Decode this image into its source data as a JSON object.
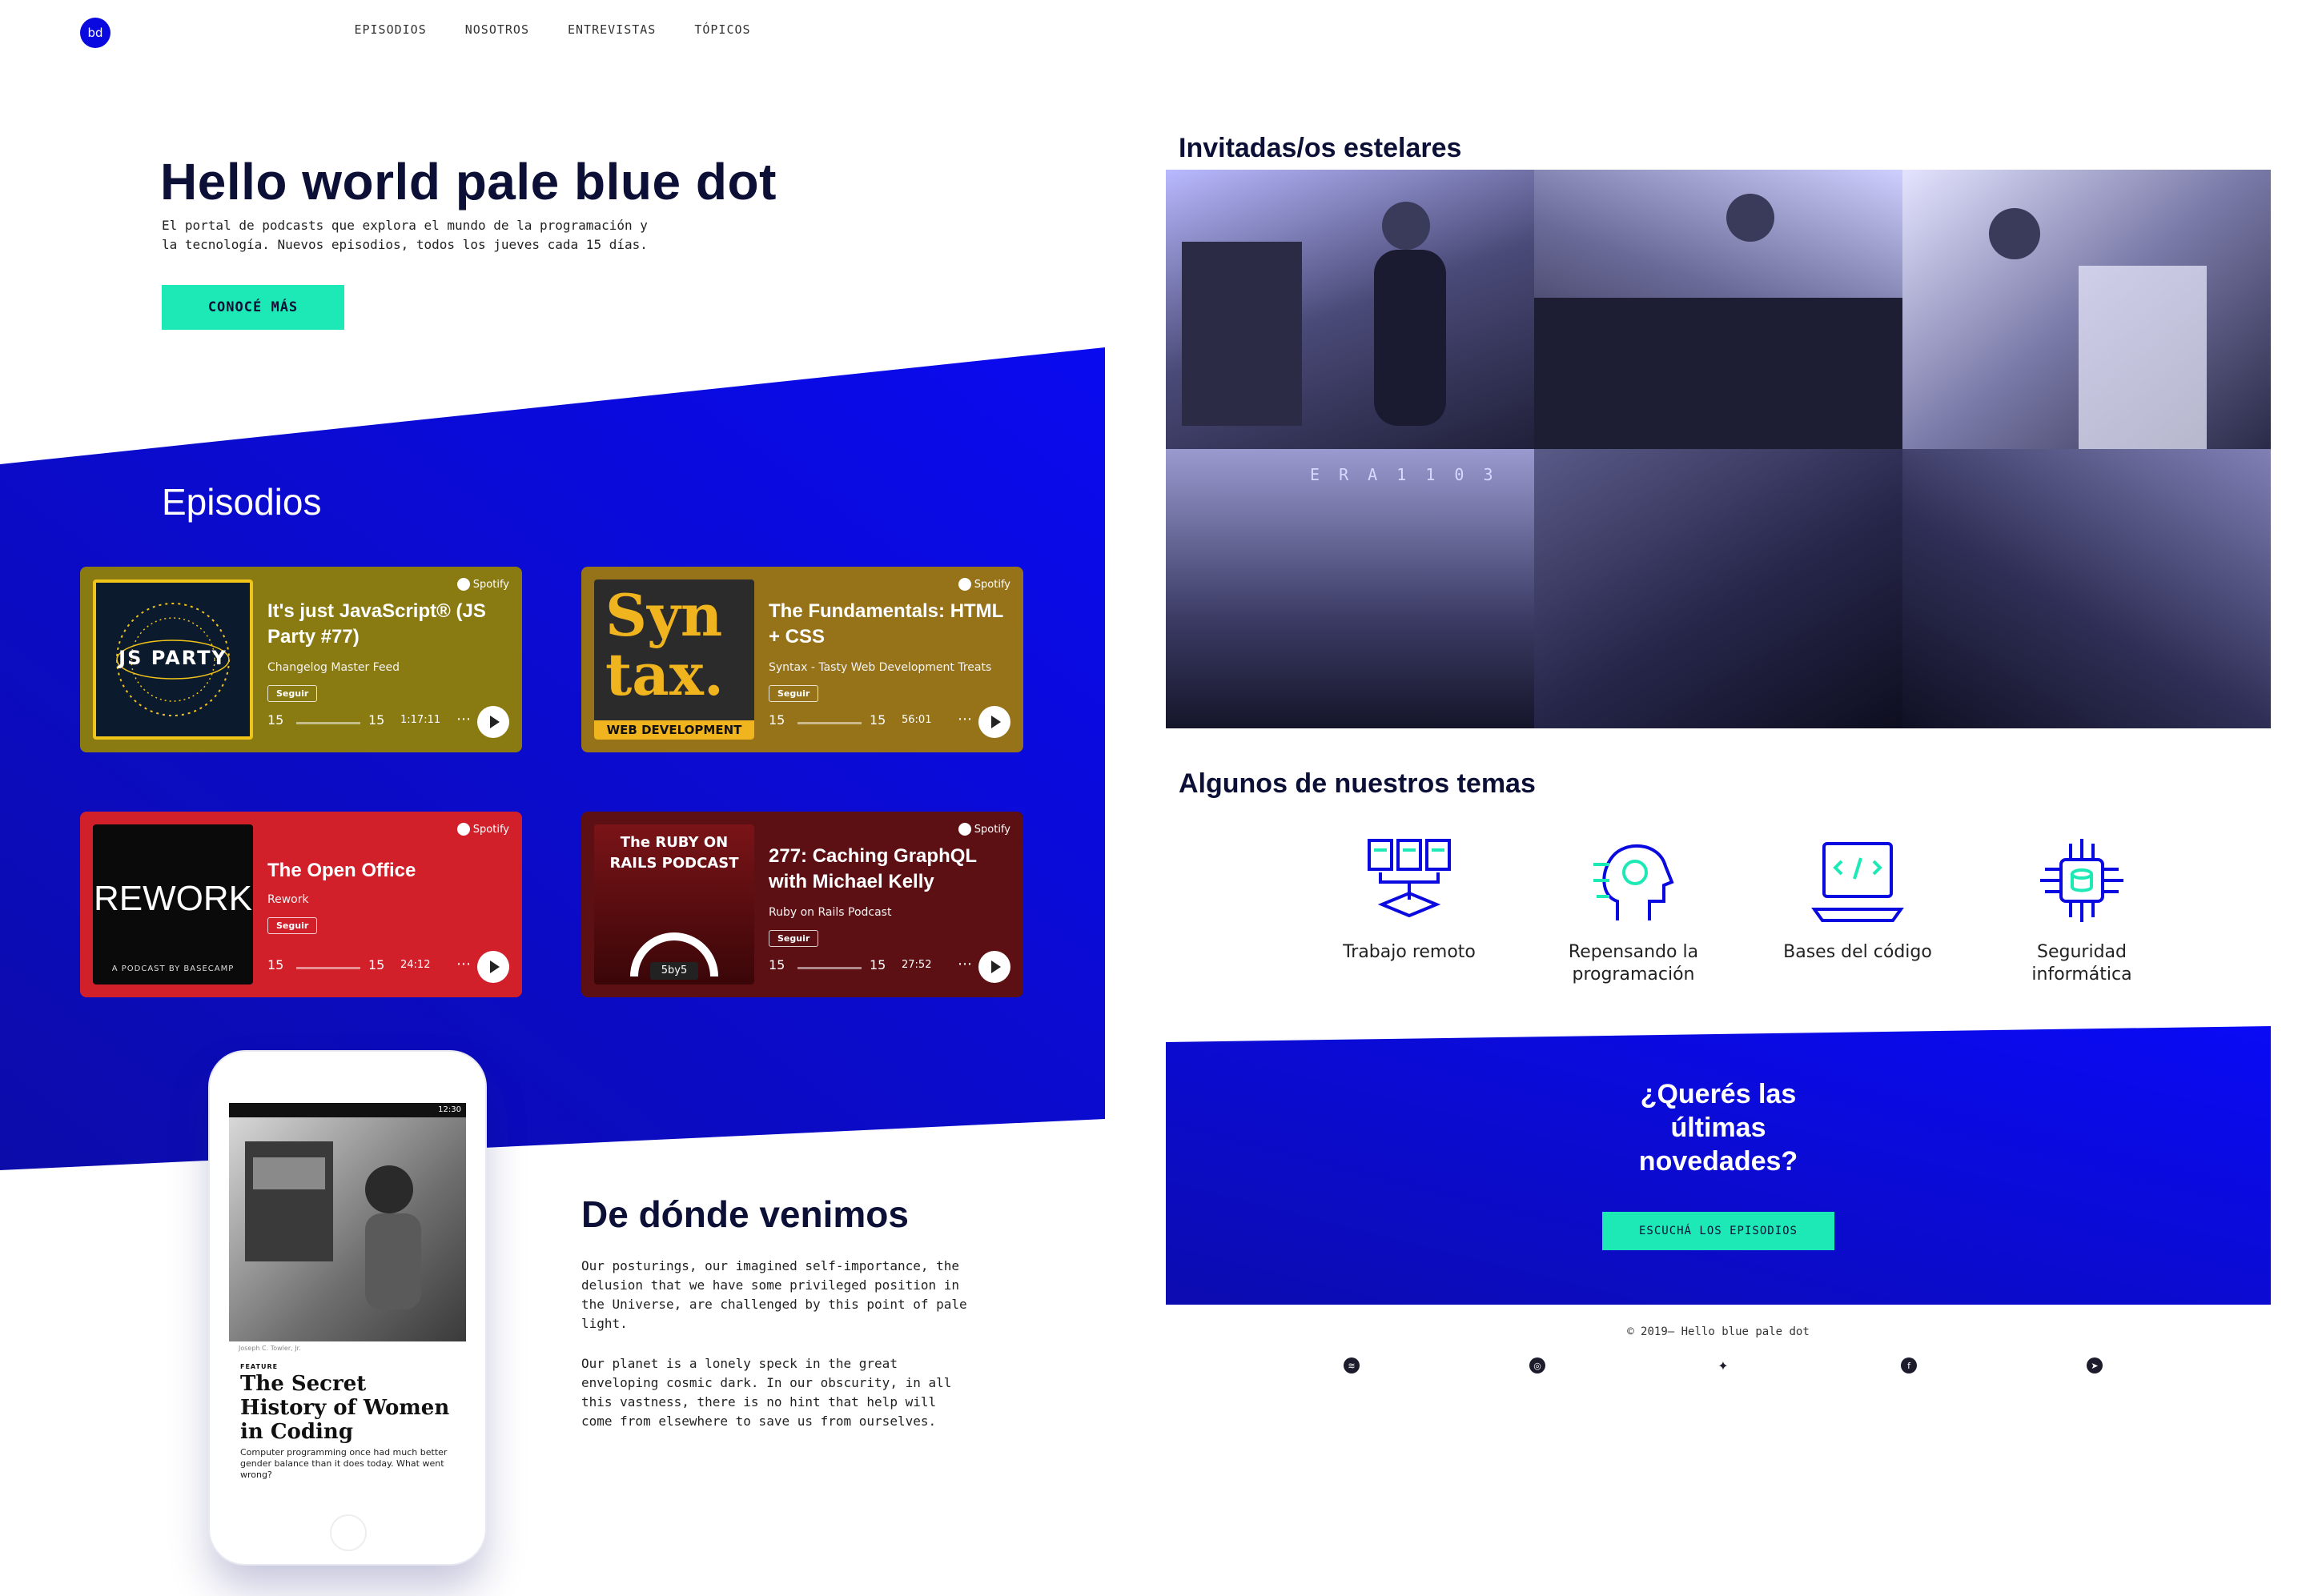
{
  "logo": "bd",
  "nav": [
    "EPISODIOS",
    "NOSOTROS",
    "ENTREVISTAS",
    "TÓPICOS"
  ],
  "hero": {
    "title": "Hello world pale blue dot",
    "subtitle_1": "El portal de podcasts que explora el mundo de la programación y",
    "subtitle_2": "la tecnología. Nuevos episodios, todos los jueves cada 15 días.",
    "cta": "CONOCÉ MÁS"
  },
  "episodes_section": {
    "title": "Episodios",
    "cards": [
      {
        "title": "It's just JavaScript® (JS Party #77)",
        "author": "Changelog Master Feed",
        "follow": "Seguir",
        "brand": "Spotify",
        "time": "1:17:11",
        "cover_text": "JS PARTY",
        "color": "#8a7a12"
      },
      {
        "title": "The Fundamentals: HTML + CSS",
        "author": "Syntax - Tasty Web Development Treats",
        "follow": "Seguir",
        "brand": "Spotify",
        "time": "56:01",
        "cover_text": "Syn tax.",
        "cover_sub": "WEB DEVELOPMENT",
        "color": "#967318"
      },
      {
        "title": "The Open Office",
        "author": "Rework",
        "follow": "Seguir",
        "brand": "Spotify",
        "time": "24:12",
        "cover_text": "REWORK",
        "cover_sub": "A PODCAST BY BASECAMP",
        "color": "#d1202a"
      },
      {
        "title": "277: Caching GraphQL with Michael Kelly",
        "author": "Ruby on Rails Podcast",
        "follow": "Seguir",
        "brand": "Spotify",
        "time": "27:52",
        "cover_text": "The RUBY ON RAILS PODCAST",
        "cover_sub": "5by5",
        "color": "#5c1014"
      }
    ],
    "skip": "15"
  },
  "phone": {
    "status": "12:30",
    "credit": "Joseph C. Towler, Jr.",
    "feature": "FEATURE",
    "headline": "The Secret History of Women in Coding",
    "desc": "Computer programming once had much better gender balance than it does today. What went wrong?"
  },
  "origins": {
    "title": "De dónde venimos",
    "p1": "Our posturings, our imagined self-importance, the delusion that we have some privileged position in the Universe, are challenged by this point of pale light.",
    "p2": "Our planet is a lonely speck in the great enveloping cosmic dark. In our obscurity, in all this vastness, there is no hint that help will come from elsewhere to save us from ourselves."
  },
  "guests": {
    "title": "Invitadas/os estelares",
    "grid_label": "E R A   1 1 0 3"
  },
  "topics": {
    "title": "Algunos de nuestros temas",
    "items": [
      {
        "label": "Trabajo remoto",
        "icon": "remote-work-icon"
      },
      {
        "label": "Repensando la programación",
        "icon": "ai-head-icon"
      },
      {
        "label": "Bases del código",
        "icon": "laptop-code-icon"
      },
      {
        "label": "Seguridad informática",
        "icon": "security-chip-icon"
      }
    ]
  },
  "newsletter": {
    "title_1": "¿Querés las",
    "title_2": "últimas",
    "title_3": "novedades?",
    "cta": "ESCUCHÁ LOS EPISODIOS"
  },
  "footer": {
    "copyright": "© 2019— Hello blue pale dot",
    "socials": [
      "spotify-icon",
      "instagram-icon",
      "twitter-icon",
      "facebook-icon",
      "telegram-icon"
    ]
  },
  "colors": {
    "accent": "#1de9b6",
    "blue": "#0a0ae0",
    "navy": "#0c1036"
  }
}
